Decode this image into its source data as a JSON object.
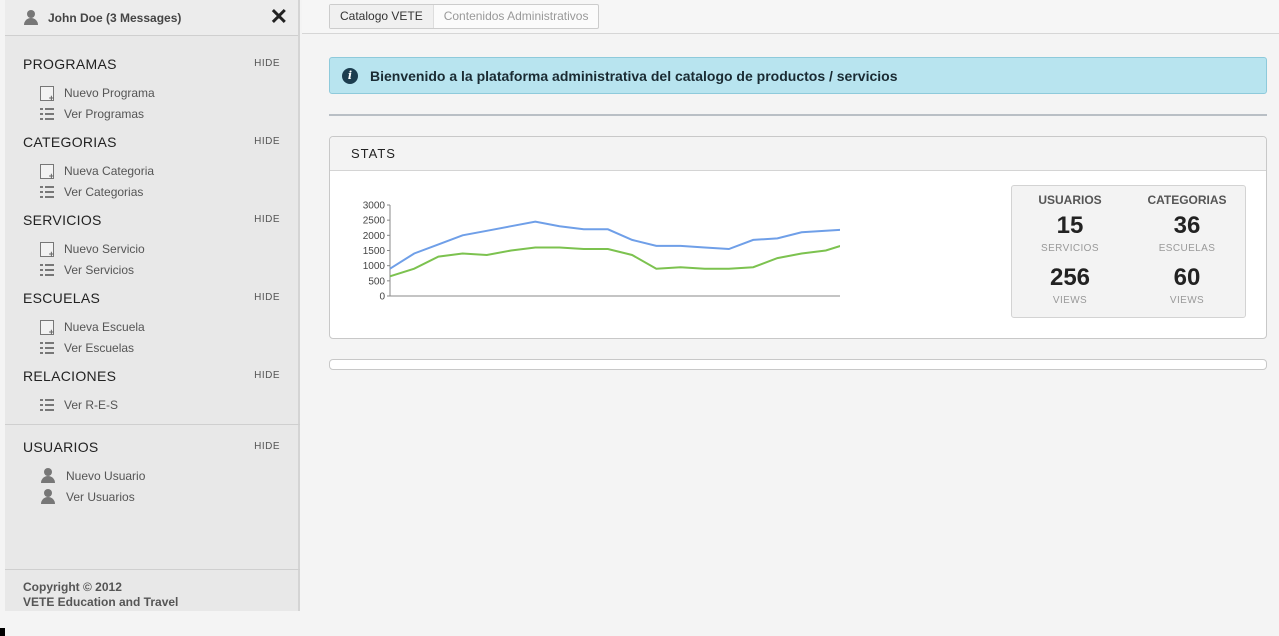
{
  "user": {
    "name": "John Doe (3 Messages)",
    "icon": "user-icon",
    "close_icon": "close-icon"
  },
  "nav": {
    "hide_label": "HIDE",
    "sections": [
      {
        "title": "PROGRAMAS",
        "items": [
          {
            "label": "Nuevo Programa",
            "icon": "add-document-icon"
          },
          {
            "label": "Ver Programas",
            "icon": "list-icon"
          }
        ]
      },
      {
        "title": "CATEGORIAS",
        "items": [
          {
            "label": "Nueva Categoria",
            "icon": "add-document-icon"
          },
          {
            "label": "Ver Categorias",
            "icon": "list-icon"
          }
        ]
      },
      {
        "title": "SERVICIOS",
        "items": [
          {
            "label": "Nuevo Servicio",
            "icon": "add-document-icon"
          },
          {
            "label": "Ver Servicios",
            "icon": "list-icon"
          }
        ]
      },
      {
        "title": "ESCUELAS",
        "items": [
          {
            "label": "Nueva Escuela",
            "icon": "add-document-icon"
          },
          {
            "label": "Ver Escuelas",
            "icon": "list-icon"
          }
        ]
      },
      {
        "title": "RELACIONES",
        "items": [
          {
            "label": "Ver R-E-S",
            "icon": "list-icon"
          }
        ]
      },
      {
        "title": "USUARIOS",
        "items": [
          {
            "label": "Nuevo Usuario",
            "icon": "add-user-icon"
          },
          {
            "label": "Ver Usuarios",
            "icon": "user-icon"
          }
        ]
      }
    ]
  },
  "footer": {
    "line1": "Copyright © 2012",
    "line2": "VETE Education and Travel"
  },
  "breadcrumb": [
    "Catalogo VETE",
    "Contenidos Administrativos"
  ],
  "alert": {
    "icon": "info-icon",
    "message": "Bienvenido a la plataforma administrativa del catalogo de productos / servicios",
    "bg_color": "#b8e4ef"
  },
  "stats": {
    "title": "STATS",
    "cells": [
      {
        "head": "USUARIOS",
        "value": "15",
        "sub": "SERVICIOS"
      },
      {
        "head": "CATEGORIAS",
        "value": "36",
        "sub": "ESCUELAS"
      },
      {
        "head": "",
        "value": "256",
        "sub": "VIEWS"
      },
      {
        "head": "",
        "value": "60",
        "sub": "VIEWS"
      }
    ]
  },
  "chart_data": {
    "type": "line",
    "title": "",
    "xlabel": "",
    "ylabel": "",
    "ylim": [
      0,
      3000
    ],
    "yticks": [
      "3000",
      "2500",
      "2000",
      "1500",
      "1000",
      "500",
      "0"
    ],
    "x": [
      0,
      1,
      2,
      3,
      4,
      5,
      6,
      7,
      8,
      9,
      10,
      11,
      12,
      13,
      14,
      15,
      16,
      17,
      18,
      19
    ],
    "series": [
      {
        "color": "#6f9fe8",
        "values": [
          900,
          1400,
          1700,
          2000,
          2150,
          2300,
          2450,
          2300,
          2200,
          2200,
          1850,
          1650,
          1650,
          1600,
          1550,
          1850,
          1900,
          2100,
          2150,
          2200
        ]
      },
      {
        "color": "#7cc24f",
        "values": [
          650,
          900,
          1300,
          1400,
          1350,
          1500,
          1600,
          1600,
          1550,
          1550,
          1350,
          900,
          950,
          900,
          900,
          950,
          1250,
          1400,
          1500,
          1750
        ]
      }
    ]
  }
}
